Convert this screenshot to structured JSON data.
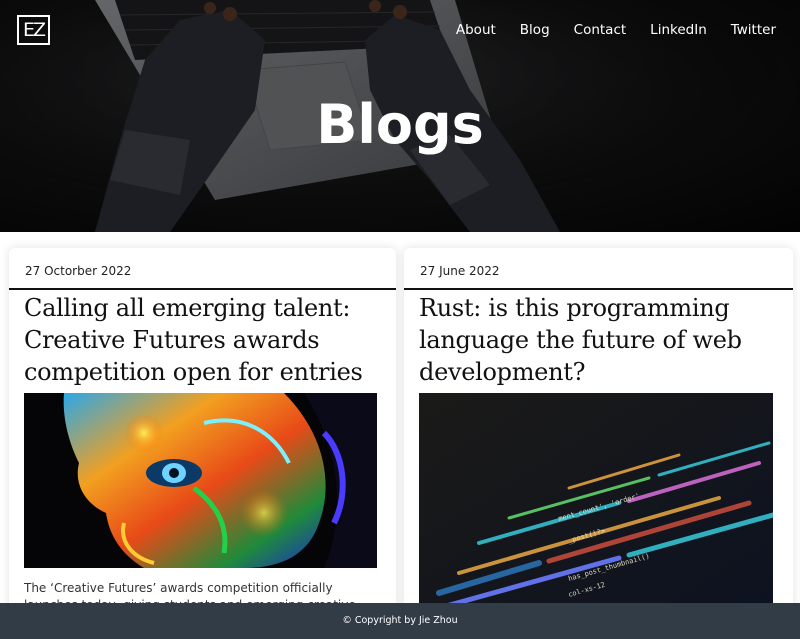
{
  "header": {
    "logo_text": "EZ",
    "nav": [
      "About",
      "Blog",
      "Contact",
      "LinkedIn",
      "Twitter"
    ],
    "title": "Blogs"
  },
  "posts": [
    {
      "date": "27 Octorber 2022",
      "title": "Calling all emerging talent: Creative Futures awards competition open for entries",
      "image": "painted-face-image",
      "excerpt": "The ‘Creative Futures’ awards competition officially launches today, giving students and emerging creative talent the chance"
    },
    {
      "date": "27 June 2022",
      "title": "Rust: is this programming language the future of web development?",
      "image": "code-screen-image",
      "code_fragments": [
        "ment_count', 'order'",
        "_post()?>",
        "has_post_thumbnail()",
        "col-xs-12"
      ]
    }
  ],
  "footer": {
    "text": "© Copyright by Jie Zhou"
  },
  "colors": {
    "footer_bg": "#323c46",
    "hero_bg": "#121213",
    "text": "#111111"
  }
}
